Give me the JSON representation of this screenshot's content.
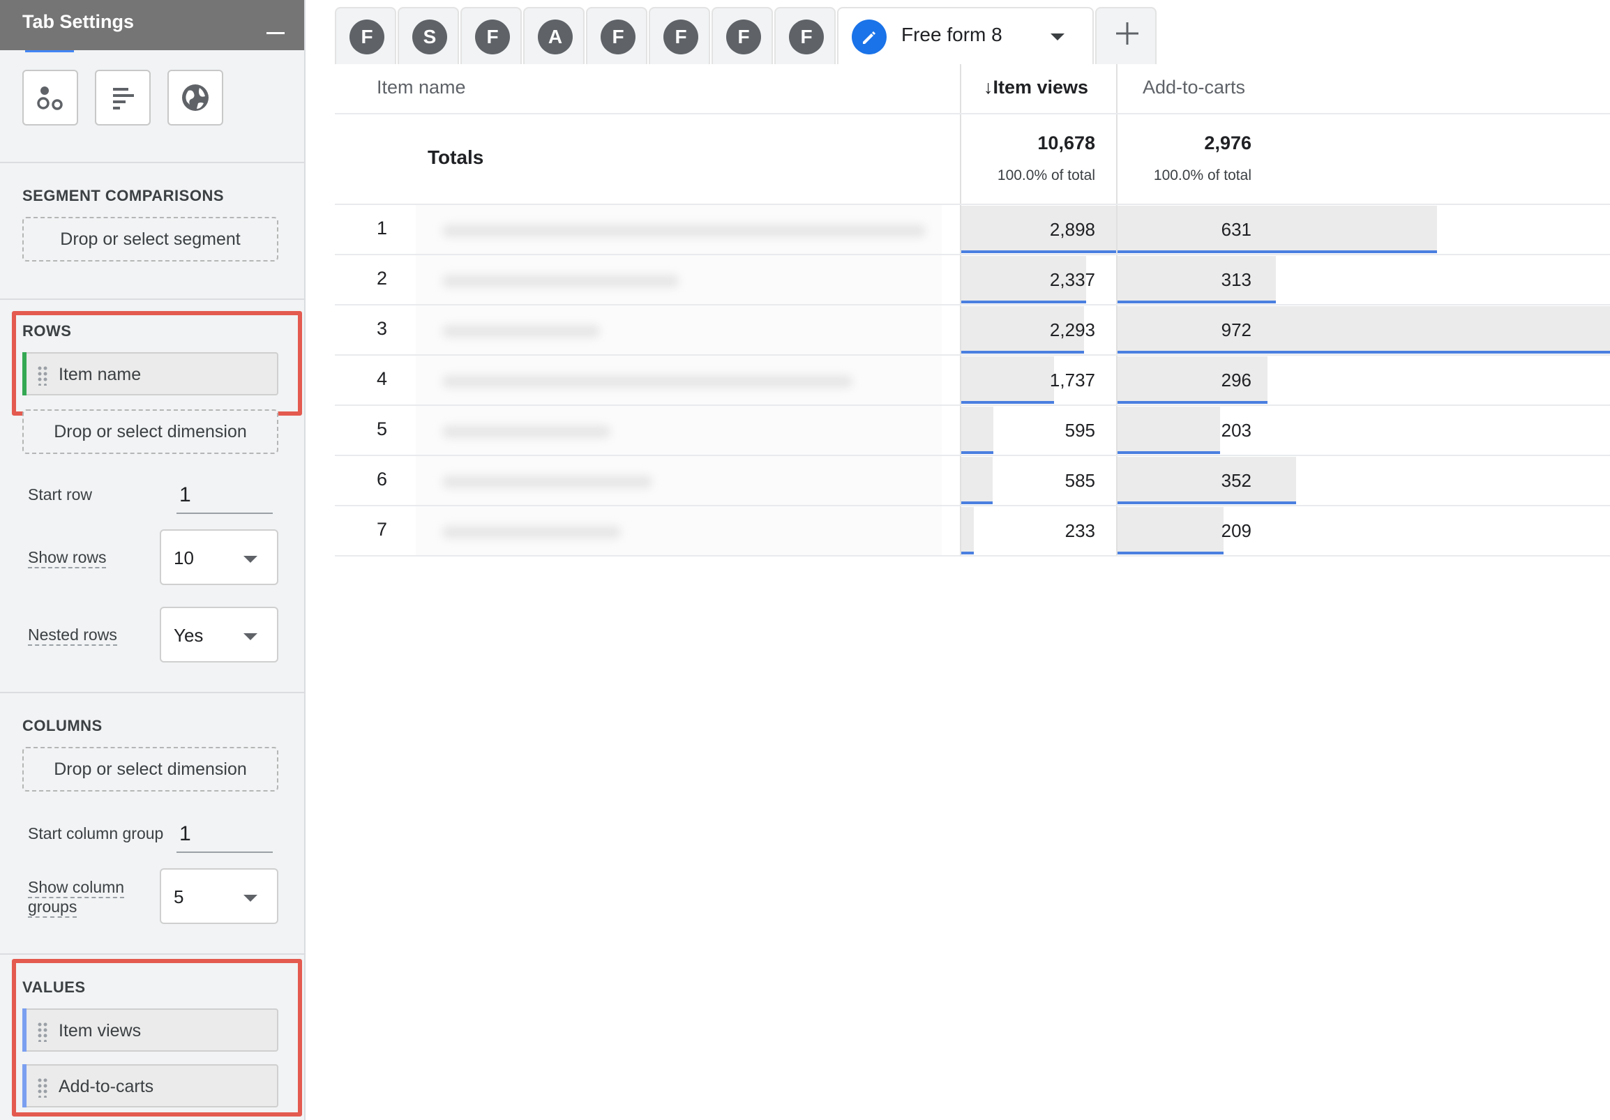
{
  "sidebar": {
    "title": "Tab Settings",
    "segment_comparisons": {
      "title": "SEGMENT COMPARISONS",
      "dropzone": "Drop or select segment"
    },
    "rows": {
      "title": "ROWS",
      "chip": "Item name",
      "dropzone": "Drop or select dimension",
      "start_row_label": "Start row",
      "start_row_value": "1",
      "show_rows_label": "Show rows",
      "show_rows_value": "10",
      "nested_rows_label": "Nested rows",
      "nested_rows_value": "Yes"
    },
    "columns": {
      "title": "COLUMNS",
      "dropzone": "Drop or select dimension",
      "start_group_label": "Start column group",
      "start_group_value": "1",
      "show_groups_label_1": "Show column",
      "show_groups_label_2": "groups",
      "show_groups_value": "5"
    },
    "values": {
      "title": "VALUES",
      "chips": [
        "Item views",
        "Add-to-carts"
      ]
    }
  },
  "tabs": {
    "items": [
      "F",
      "S",
      "F",
      "A",
      "F",
      "F",
      "F",
      "F"
    ],
    "active": "Free form 8"
  },
  "table": {
    "columns": {
      "item_name": "Item name",
      "item_views": "Item views",
      "add_to_carts": "Add-to-carts"
    },
    "totals": {
      "label": "Totals",
      "item_views": "10,678",
      "item_views_pct": "100.0% of total",
      "add_to_carts": "2,976",
      "add_to_carts_pct": "100.0% of total"
    },
    "rows": [
      {
        "num": "1",
        "views": "2,898",
        "views_n": 2898,
        "carts": "631",
        "carts_n": 631
      },
      {
        "num": "2",
        "views": "2,337",
        "views_n": 2337,
        "carts": "313",
        "carts_n": 313
      },
      {
        "num": "3",
        "views": "2,293",
        "views_n": 2293,
        "carts": "972",
        "carts_n": 972
      },
      {
        "num": "4",
        "views": "1,737",
        "views_n": 1737,
        "carts": "296",
        "carts_n": 296
      },
      {
        "num": "5",
        "views": "595",
        "views_n": 595,
        "carts": "203",
        "carts_n": 203
      },
      {
        "num": "6",
        "views": "585",
        "views_n": 585,
        "carts": "352",
        "carts_n": 352
      },
      {
        "num": "7",
        "views": "233",
        "views_n": 233,
        "carts": "209",
        "carts_n": 209
      }
    ]
  },
  "colors": {
    "accent_blue": "#4a7fe0",
    "rows_chip_accent": "#34a853",
    "values_chip_accent": "#7b9ff0",
    "highlight": "#e45a4f"
  }
}
